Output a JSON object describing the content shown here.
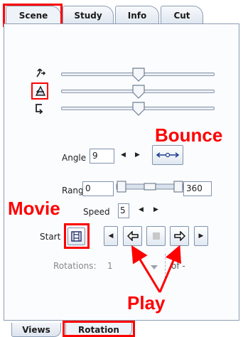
{
  "tabs": [
    "Scene",
    "Study",
    "Info",
    "Cut"
  ],
  "bottom_tabs": [
    "Views",
    "Rotation"
  ],
  "sliders": [
    {
      "icon": "rotate-x-icon",
      "level": 0.48
    },
    {
      "icon": "rotate-y-icon",
      "level": 0.48
    },
    {
      "icon": "rotate-z-icon",
      "level": 0.48
    }
  ],
  "angle": {
    "label": "Angle",
    "value": "9"
  },
  "range": {
    "label": "Range",
    "min": "0",
    "max": "360"
  },
  "speed": {
    "label": "Speed",
    "value": "5"
  },
  "start": {
    "label": "Start"
  },
  "rotations": {
    "label": "Rotations:",
    "count": "1",
    "of": "of -"
  },
  "annotations": {
    "bounce": "Bounce",
    "movie": "Movie",
    "play": "Play"
  },
  "colors": {
    "annotation": "#ff0000",
    "border": "#8c9db4"
  }
}
